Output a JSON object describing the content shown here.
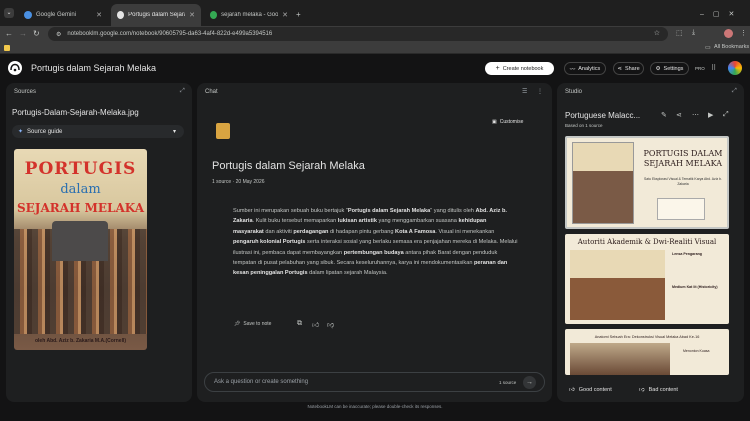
{
  "browser": {
    "tabs": [
      {
        "label": "Google Gemini",
        "active": false
      },
      {
        "label": "Portugis dalam Sejarah Melaka",
        "active": true
      },
      {
        "label": "sejarah melaka - Google Search",
        "active": false
      }
    ],
    "url": "notebooklm.google.com/notebook/90605795-da63-4af4-822d-e499a5394516",
    "bookmarks_label": "All Bookmarks",
    "new_tab": "+"
  },
  "header": {
    "title": "Portugis dalam Sejarah Melaka",
    "create_notebook": "Create notebook",
    "analytics": "Analytics",
    "share": "Share",
    "settings": "Settings",
    "pro": "PRO"
  },
  "sources": {
    "title": "Sources",
    "file_name": "Portugis-Dalam-Sejarah-Melaka.jpg",
    "source_guide": "Source guide",
    "cover": {
      "line1": "PORTUGIS",
      "line2": "dalam",
      "line3": "SEJARAH MELAKA",
      "author": "oleh Abd. Aziz b. Zakaria M.A.(Cornell)"
    }
  },
  "chat": {
    "title": "Chat",
    "customise": "Customise",
    "notebook_title": "Portugis dalam Sejarah Melaka",
    "meta": "1 source · 20 May 2026",
    "summary_parts": [
      {
        "t": "Sumber ini merupakan sebuah buku bertajuk \"",
        "b": false
      },
      {
        "t": "Portugis dalam Sejarah Melaka",
        "b": true
      },
      {
        "t": "\" yang ditulis oleh ",
        "b": false
      },
      {
        "t": "Abd. Aziz b. Zakaria",
        "b": true
      },
      {
        "t": ". Kulit buku tersebut memaparkan ",
        "b": false
      },
      {
        "t": "lukisan artistik",
        "b": true
      },
      {
        "t": " yang menggambarkan suasana ",
        "b": false
      },
      {
        "t": "kehidupan masyarakat",
        "b": true
      },
      {
        "t": " dan aktiviti ",
        "b": false
      },
      {
        "t": "perdagangan",
        "b": true
      },
      {
        "t": " di hadapan pintu gerbang ",
        "b": false
      },
      {
        "t": "Kota A Famosa",
        "b": true
      },
      {
        "t": ". Visual ini menekankan ",
        "b": false
      },
      {
        "t": "pengaruh kolonial Portugis",
        "b": true
      },
      {
        "t": " serta interaksi sosial yang berlaku semasa era penjajahan mereka di Melaka. Melalui ilustrasi ini, pembaca dapat membayangkan ",
        "b": false
      },
      {
        "t": "pertembungan budaya",
        "b": true
      },
      {
        "t": " antara pihak Barat dengan penduduk tempatan di pusat pelabuhan yang sibuk. Secara keseluruhannya, karya ini mendokumentasikan ",
        "b": false
      },
      {
        "t": "peranan dan kesan peninggalan Portugis",
        "b": true
      },
      {
        "t": " dalam lipatan sejarah Malaysia.",
        "b": false
      }
    ],
    "save_to_note": "Save to note",
    "input_placeholder": "Ask a question or create something",
    "source_count": "1 source"
  },
  "studio": {
    "title": "Studio",
    "item_title": "Portuguese Malacc...",
    "based_on": "Based on 1 source",
    "slide1": {
      "title": "PORTUGIS DALAM SEJARAH MELAKA",
      "subtitle": "Satu Eksplorasi Visual & Tematik Karya Abd. Aziz b. Zakaria"
    },
    "slide2": {
      "title": "Autoriti Akademik & Dwi-Realiti Visual",
      "side_title": "Lensa Pengarang",
      "side_title2": "Medium Kat lit (Historicity)"
    },
    "slide3": {
      "title": "Anatomi Sebuah Era: Dekonstruksi Visual Melaka Abad Ke-16",
      "box_label": "Menonton Kuasa"
    },
    "good_content": "Good content",
    "bad_content": "Bad content"
  },
  "footer": "NotebookLM can be inaccurate; please double-check its responses.",
  "colors": {
    "page_bg": "#131314",
    "panel_bg": "#1e1f20",
    "accent_blue": "#8ab4f8",
    "cover_red": "#d3322b",
    "cover_blue": "#2a6fb0"
  }
}
